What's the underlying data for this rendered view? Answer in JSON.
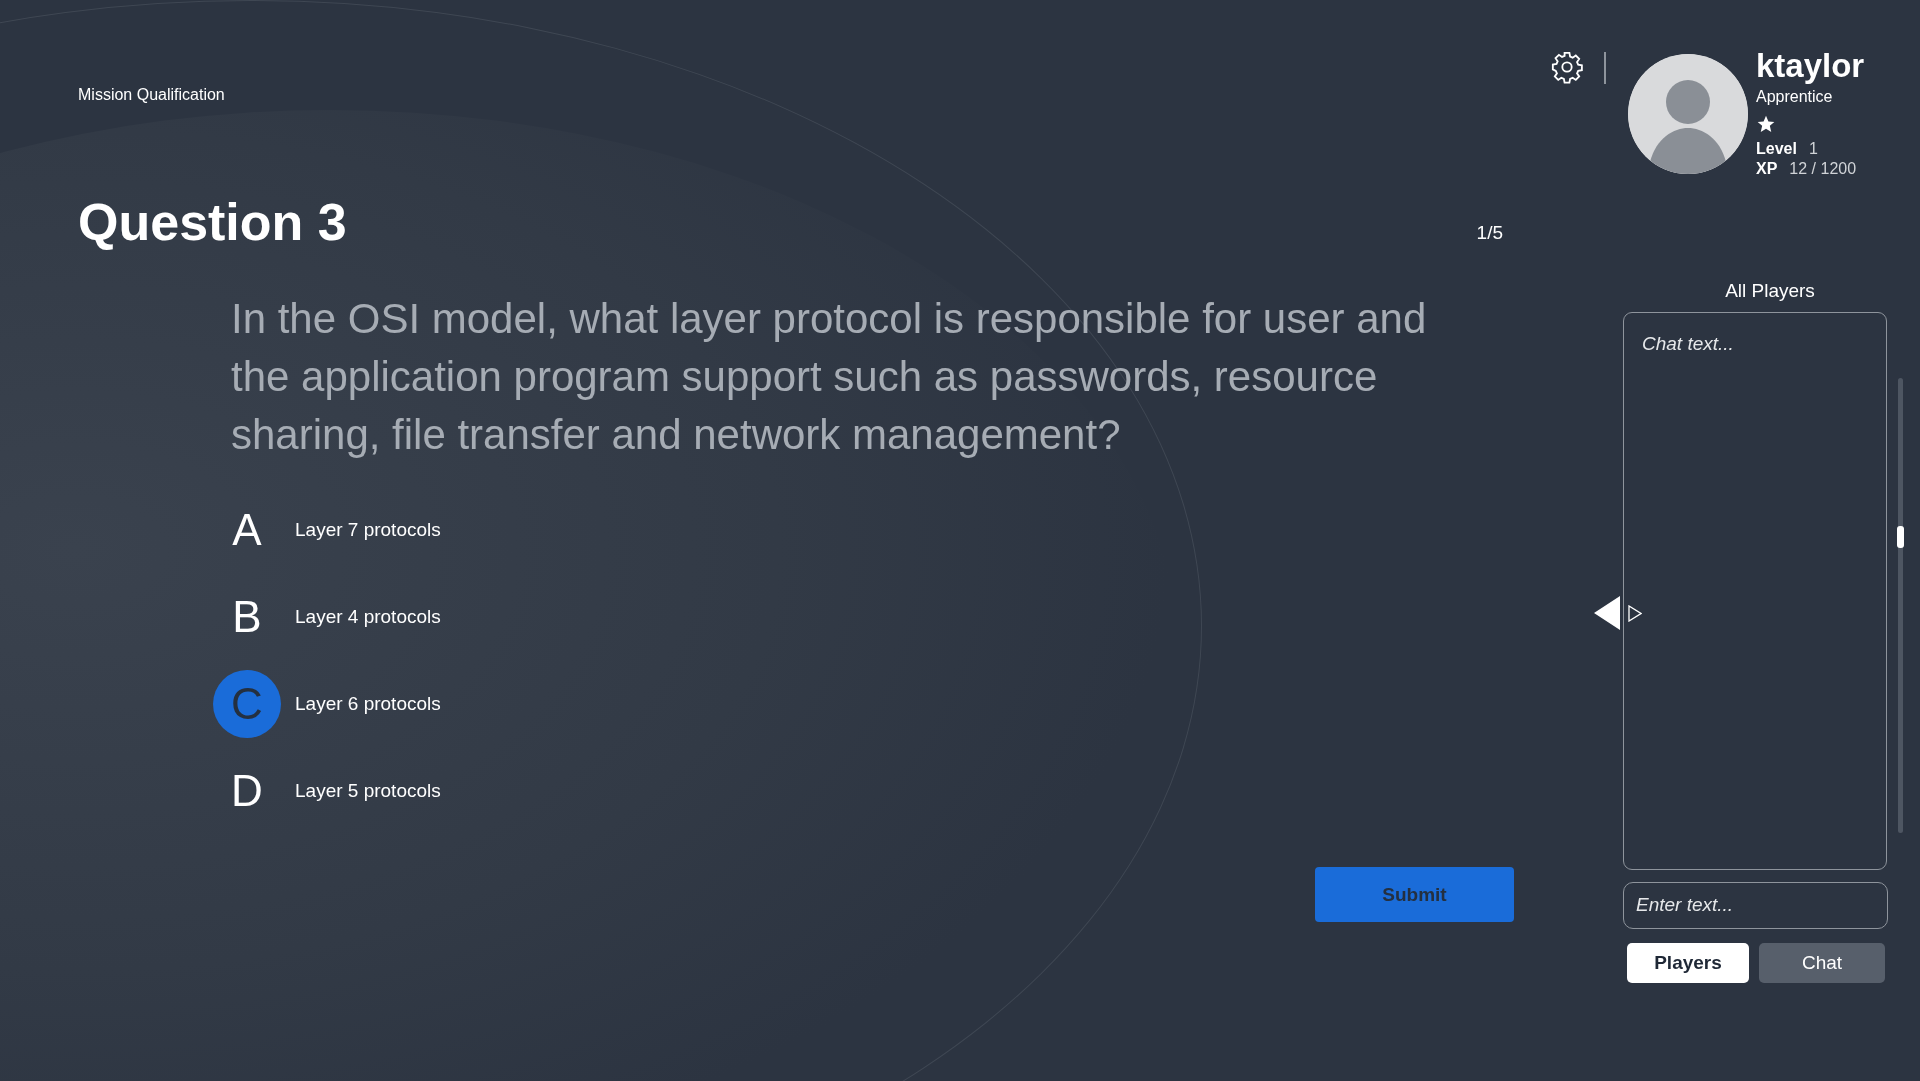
{
  "header": {
    "section": "Mission Qualification",
    "title": "Question 3",
    "progress": "1/5"
  },
  "question": "In the OSI model, what layer protocol is responsible for user and the application program support such as passwords, resource sharing, file transfer and network management?",
  "answers": [
    {
      "letter": "A",
      "text": "Layer 7 protocols",
      "selected": false
    },
    {
      "letter": "B",
      "text": "Layer 4 protocols",
      "selected": false
    },
    {
      "letter": "C",
      "text": "Layer 6 protocols",
      "selected": true
    },
    {
      "letter": "D",
      "text": "Layer 5 protocols",
      "selected": false
    }
  ],
  "submit": "Submit",
  "profile": {
    "username": "ktaylor",
    "rank": "Apprentice",
    "level_label": "Level",
    "level": "1",
    "xp_label": "XP",
    "xp": "12 / 1200"
  },
  "panel": {
    "title": "All Players",
    "chat_placeholder": "Chat text...",
    "input_placeholder": "Enter text...",
    "tabs": [
      {
        "label": "Players",
        "selected": true
      },
      {
        "label": "Chat",
        "selected": false
      }
    ]
  }
}
